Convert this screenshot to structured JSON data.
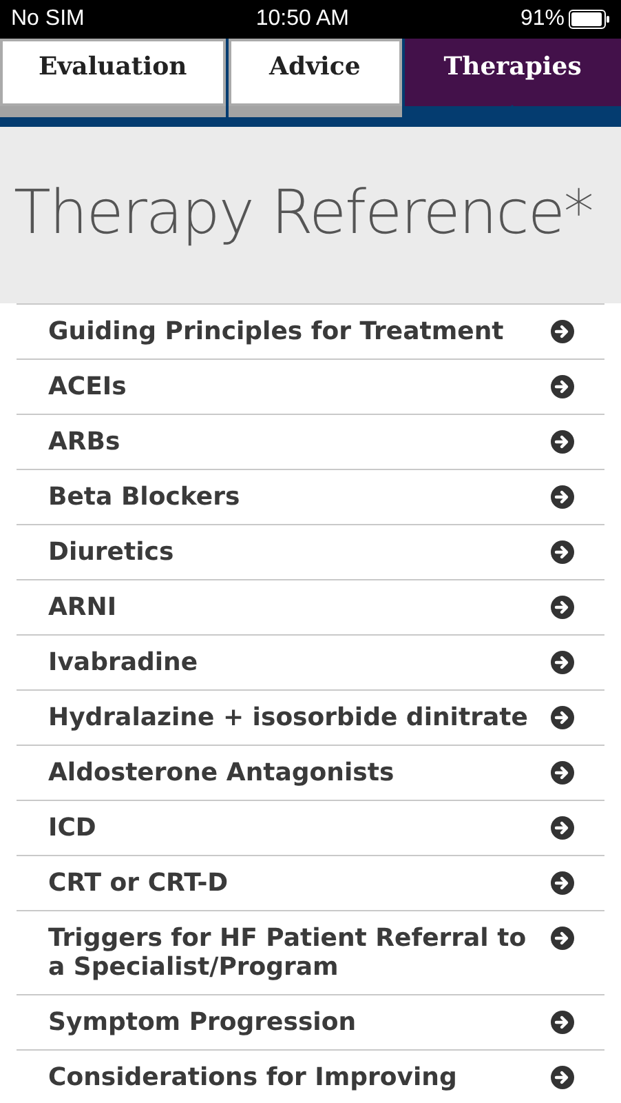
{
  "status_bar": {
    "carrier": "No SIM",
    "time": "10:50 AM",
    "battery": "91%"
  },
  "tabs": [
    {
      "label": "Evaluation",
      "selected": false
    },
    {
      "label": "Advice",
      "selected": false
    },
    {
      "label": "Therapies",
      "selected": true
    }
  ],
  "page_title": "Therapy Reference*",
  "items": [
    {
      "label": "Guiding Principles for Treatment"
    },
    {
      "label": "ACEIs"
    },
    {
      "label": "ARBs"
    },
    {
      "label": "Beta Blockers"
    },
    {
      "label": "Diuretics"
    },
    {
      "label": "ARNI"
    },
    {
      "label": "Ivabradine"
    },
    {
      "label": "Hydralazine + isosorbide dinitrate"
    },
    {
      "label": "Aldosterone Antagonists"
    },
    {
      "label": "ICD"
    },
    {
      "label": "CRT or CRT-D"
    },
    {
      "label": "Triggers for HF Patient Referral to a Specialist/Program"
    },
    {
      "label": "Symptom Progression"
    },
    {
      "label": "Considerations for Improving"
    }
  ]
}
